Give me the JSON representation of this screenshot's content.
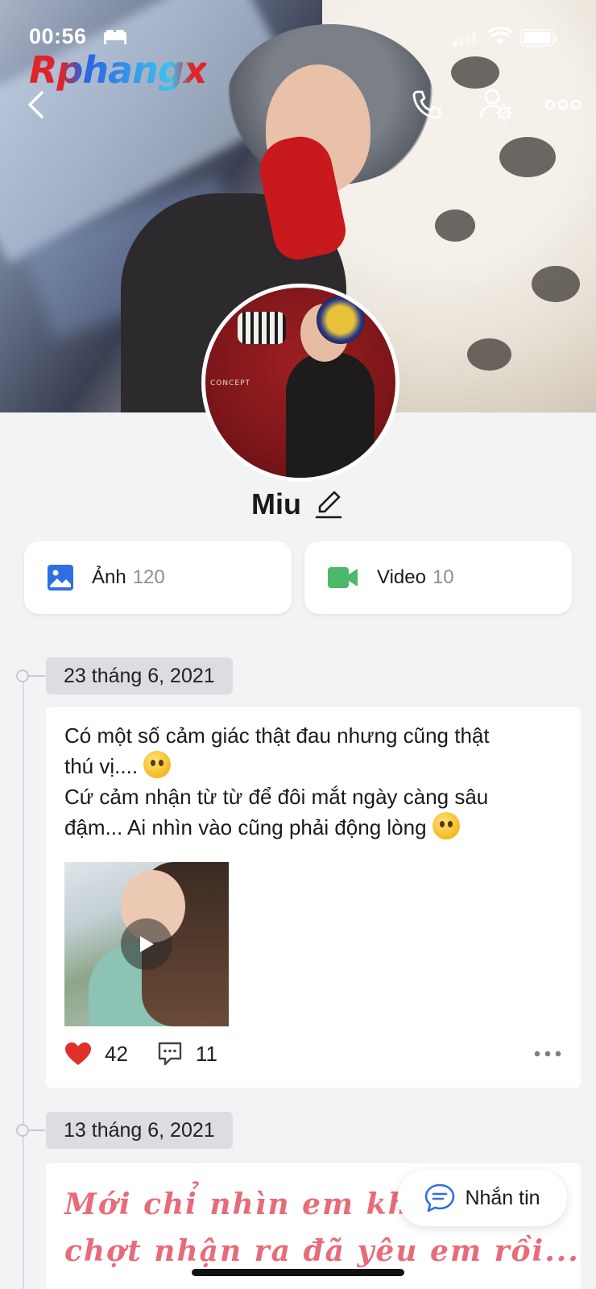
{
  "status_bar": {
    "time": "00:56"
  },
  "brand": {
    "logo_text": "Rphangx"
  },
  "profile": {
    "name": "Miu"
  },
  "media": {
    "photos_label": "Ảnh",
    "photos_count": "120",
    "videos_label": "Video",
    "videos_count": "10"
  },
  "posts": [
    {
      "date": "23 tháng 6, 2021",
      "text_line1": "Có một số cảm giác thật đau nhưng cũng thật",
      "text_line2": "thú vị....",
      "text_line3": "Cứ cảm nhận từ từ để đôi mắt ngày càng sâu",
      "text_line4": "đậm... Ai nhìn vào cũng phải động lòng",
      "likes": "42",
      "comments": "11"
    },
    {
      "date": "13 tháng 6, 2021",
      "styled_line1": "Mới chỉ nhìn em khóc",
      "styled_line2": "chợt nhận ra đã yêu em rồi..."
    }
  ],
  "message_button": {
    "label": "Nhắn tin"
  },
  "colors": {
    "accent": "#2f6fe4",
    "like": "#e0302a",
    "video_icon": "#4cb86a",
    "styled_text": "#e86b7a"
  }
}
